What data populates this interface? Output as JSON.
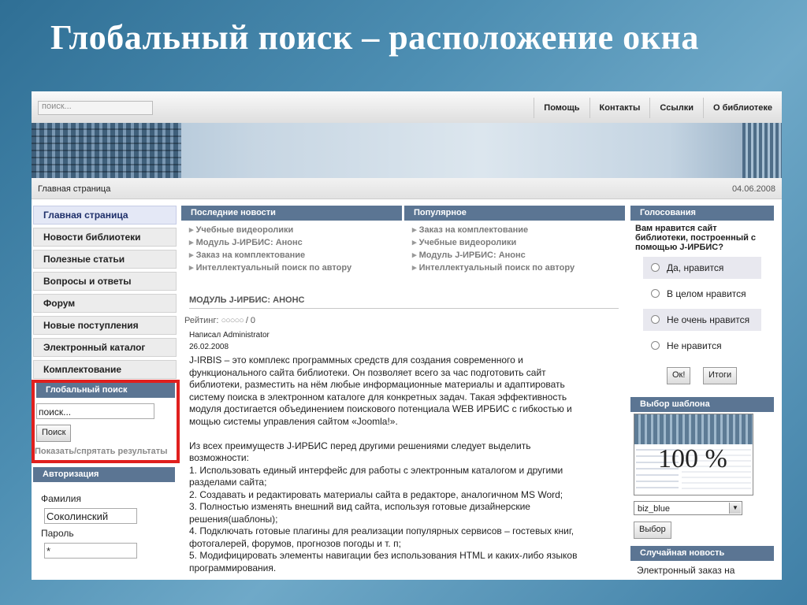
{
  "slide": {
    "title": "Глобальный поиск –  расположение окна"
  },
  "top": {
    "search_value": "поиск...",
    "nav": [
      "Помощь",
      "Контакты",
      "Ссылки",
      "О библиотеке"
    ]
  },
  "breadcrumb": "Главная страница",
  "date": "04.06.2008",
  "menu": [
    "Главная страница",
    "Новости библиотеки",
    "Полезные статьи",
    "Вопросы и ответы",
    "Форум",
    "Новые поступления",
    "Электронный каталог",
    "Комплектование"
  ],
  "global_search": {
    "header": "Глобальный поиск",
    "input_value": "поиск...",
    "button": "Поиск",
    "toggle": "Показать/спрятать результаты"
  },
  "auth": {
    "header": "Авторизация",
    "surname_label": "Фамилия",
    "surname_value": "Соколинский",
    "password_label": "Пароль",
    "password_value": "*"
  },
  "latest_news": {
    "header": "Последние новости",
    "items": [
      "Учебные видеоролики",
      "Модуль J-ИРБИС: Анонс",
      "Заказ на комплектование",
      "Интеллектуальный поиск по автору"
    ]
  },
  "popular": {
    "header": "Популярное",
    "items": [
      "Заказ на комплектование",
      "Учебные видеоролики",
      "Модуль J-ИРБИС: Анонс",
      "Интеллектуальный поиск по автору"
    ]
  },
  "article": {
    "title": "МОДУЛЬ J-ИРБИС: АНОНС",
    "rating_label": "Рейтинг:",
    "rating_value": "/ 0",
    "rating_stars": 0,
    "author": "Написал Administrator",
    "date": "26.02.2008",
    "lines": [
      "J-IRBIS – это комплекс программных средств для создания современного и",
      "функционального сайта библиотеки. Он позволяет всего за час подготовить сайт",
      "библиотеки,  разместить на нём любые информационные материалы и адаптировать",
      "систему поиска в электронном каталоге для конкретных задач. Такая эффективность",
      "модуля достигается объединением поискового потенциала WEB ИРБИС с гибкостью и",
      "мощью системы управления сайтом «Joomla!».",
      "",
      "Из всех преимуществ J-ИРБИС перед другими решениями следует выделить",
      "возможности:",
      "1. Использовать единый интерфейс для работы с электронным каталогом и другими",
      "разделами сайта;",
      "2. Создавать и редактировать материалы сайта в редакторе, аналогичном MS Word;",
      "3. Полностью изменять внешний вид сайта, используя готовые дизайнерские",
      "решения(шаблоны);",
      "4. Подключать готовые плагины для реализации популярных сервисов – гостевых книг,",
      "фотогалерей, форумов, прогнозов погоды и т. п;",
      "5. Модифицировать элементы навигации без использования  HTML и каких-либо языков",
      "программирования."
    ]
  },
  "poll": {
    "header": "Голосования",
    "question": "Вам нравится сайт библиотеки, построенный с помощью J-ИРБИС?",
    "options": [
      "Да, нравится",
      "В целом нравится",
      "Не очень нравится",
      "Не нравится"
    ],
    "ok_button": "Ок!",
    "results_button": "Итоги"
  },
  "template": {
    "header": "Выбор шаблона",
    "preview_label": "100 %",
    "selected": "biz_blue",
    "button": "Выбор"
  },
  "random_news": {
    "header": "Случайная новость",
    "text": "Электронный заказ на"
  }
}
